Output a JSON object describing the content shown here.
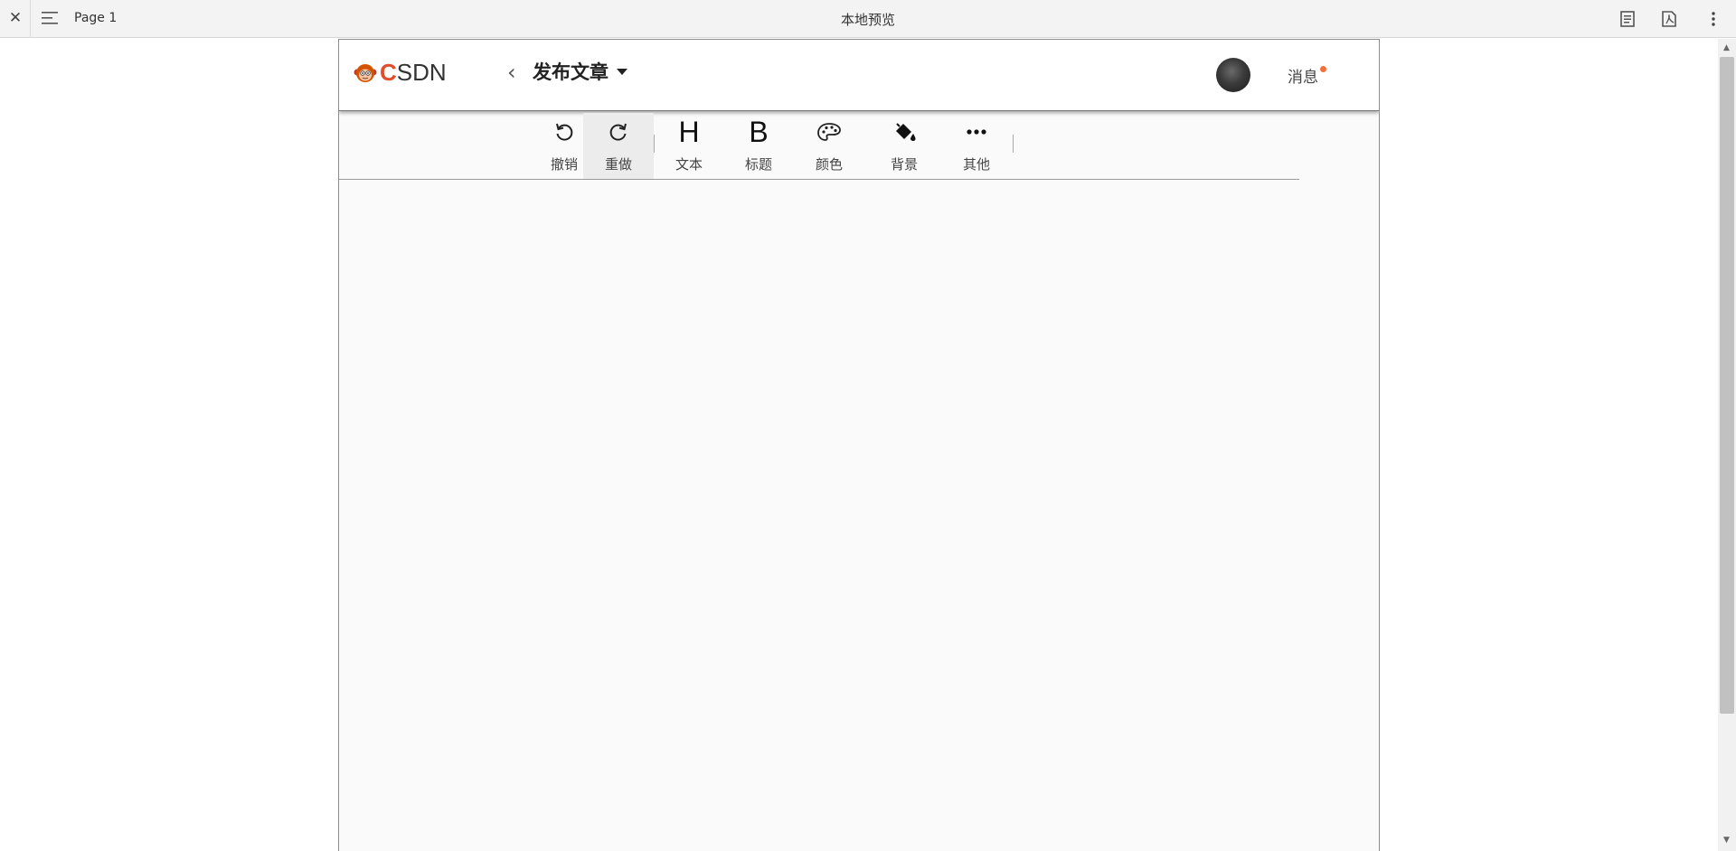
{
  "viewer": {
    "page_label": "Page 1",
    "title": "本地预览"
  },
  "header": {
    "logo_text_accent": "C",
    "logo_text_rest": "SDN",
    "page_title": "发布文章",
    "messages_label": "消息",
    "message_dot_color": "#f2703c"
  },
  "toolbar": {
    "items": [
      {
        "label": "撤销",
        "icon": "undo-icon"
      },
      {
        "label": "重做",
        "icon": "redo-icon",
        "active": true
      },
      {
        "label": "文本",
        "icon": "heading-h-icon",
        "glyph": "H"
      },
      {
        "label": "标题",
        "icon": "bold-b-icon",
        "glyph": "B"
      },
      {
        "label": "颜色",
        "icon": "palette-icon"
      },
      {
        "label": "背景",
        "icon": "paint-bucket-icon"
      },
      {
        "label": "其他",
        "icon": "more-dots-icon"
      }
    ]
  },
  "colors": {
    "accent": "#e24e2b",
    "canvas_bg": "#fafafa"
  }
}
